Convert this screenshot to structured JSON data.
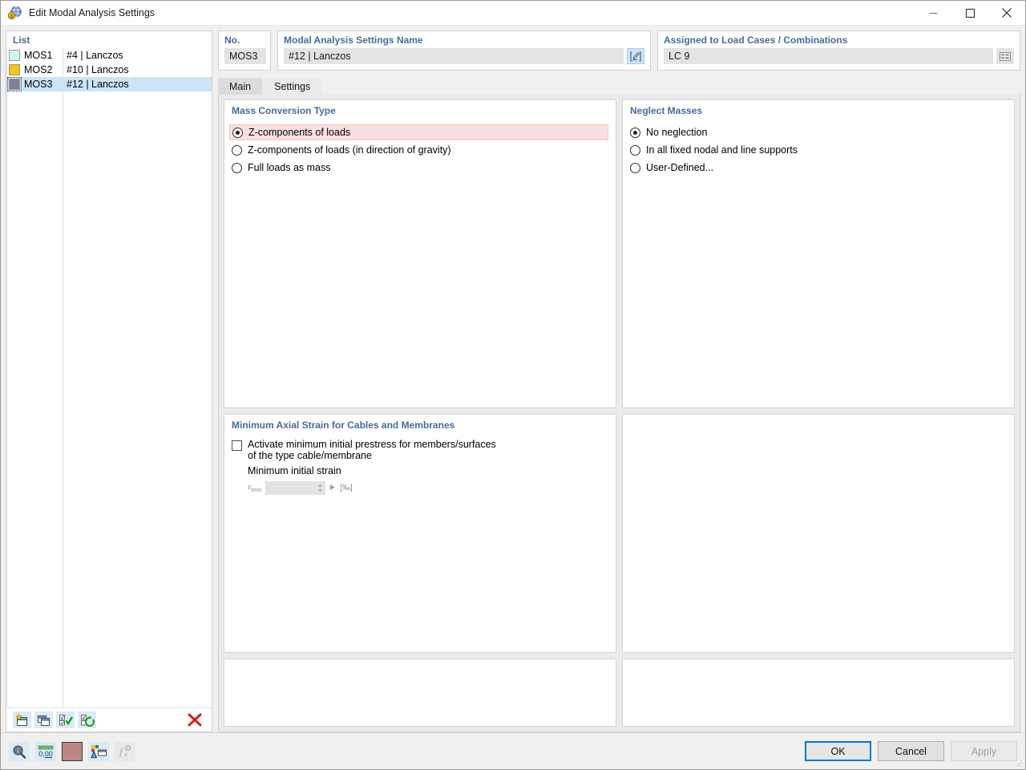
{
  "window": {
    "title": "Edit Modal Analysis Settings",
    "icon": "modal-analysis-icon",
    "minimize_label": "Minimize",
    "maximize_label": "Maximize",
    "close_label": "Close"
  },
  "list": {
    "header": "List",
    "rows": [
      {
        "no": "MOS1",
        "label": "#4 | Lanczos",
        "color": "#ccf5f5",
        "selected": false
      },
      {
        "no": "MOS2",
        "label": "#10 | Lanczos",
        "color": "#f5c414",
        "selected": false
      },
      {
        "no": "MOS3",
        "label": "#12 | Lanczos",
        "color": "#827d96",
        "selected": true
      }
    ],
    "toolbar": [
      {
        "name": "new-item-button",
        "title": "New"
      },
      {
        "name": "copy-item-button",
        "title": "Copy"
      },
      {
        "name": "select-all-button",
        "title": "Select All"
      },
      {
        "name": "invert-selection-button",
        "title": "Invert Selection"
      },
      {
        "name": "delete-item-button",
        "title": "Delete"
      }
    ]
  },
  "no_field": {
    "label": "No.",
    "value": "MOS3"
  },
  "name_field": {
    "label": "Modal Analysis Settings Name",
    "value": "#12 | Lanczos",
    "placeholder": "",
    "edit_button": "edit-name-icon"
  },
  "assigned_field": {
    "label": "Assigned to Load Cases / Combinations",
    "value": "LC 9",
    "placeholder": "",
    "browse_button": "load-case-table-icon"
  },
  "tabs": [
    {
      "label": "Main",
      "active": false
    },
    {
      "label": "Settings",
      "active": true
    }
  ],
  "mass_conversion": {
    "title": "Mass Conversion Type",
    "options": [
      {
        "label": "Z-components of loads",
        "selected": true,
        "highlighted": true
      },
      {
        "label": "Z-components of loads (in direction of gravity)",
        "selected": false,
        "highlighted": false
      },
      {
        "label": "Full loads as mass",
        "selected": false,
        "highlighted": false
      }
    ]
  },
  "neglect_masses": {
    "title": "Neglect Masses",
    "options": [
      {
        "label": "No neglection",
        "selected": true
      },
      {
        "label": "In all fixed nodal and line supports",
        "selected": false
      },
      {
        "label": "User-Defined...",
        "selected": false
      }
    ]
  },
  "min_axial_strain": {
    "title": "Minimum Axial Strain for Cables and Membranes",
    "checkbox_label_line1": "Activate minimum initial prestress for members/surfaces",
    "checkbox_label_line2": "of the type cable/membrane",
    "checked": false,
    "sub_label": "Minimum initial strain",
    "spinner_symbol": "ε",
    "spinner_subscript": "min",
    "spinner_value": "",
    "unit": "[‰]"
  },
  "footer": {
    "tools": [
      {
        "name": "info-magnifier-button",
        "title": "Info"
      },
      {
        "name": "decimal-places-button",
        "title": "Decimal Places",
        "text": "0,00"
      },
      {
        "name": "color-chip-button",
        "title": "Color",
        "color": "#bb8784"
      },
      {
        "name": "display-properties-button",
        "title": "Display Properties"
      },
      {
        "name": "formula-button",
        "title": "Formula",
        "disabled": true
      }
    ],
    "buttons": [
      {
        "label": "OK",
        "style": "primary",
        "disabled": false
      },
      {
        "label": "Cancel",
        "style": "normal",
        "disabled": false
      },
      {
        "label": "Apply",
        "style": "normal",
        "disabled": true
      }
    ]
  },
  "colors": {
    "accent_blue": "#4a6a9a",
    "selection_blue": "#cce4f7",
    "highlight_pink": "#fadfe0",
    "focus_blue": "#0078d7",
    "delete_red": "#d02020"
  }
}
